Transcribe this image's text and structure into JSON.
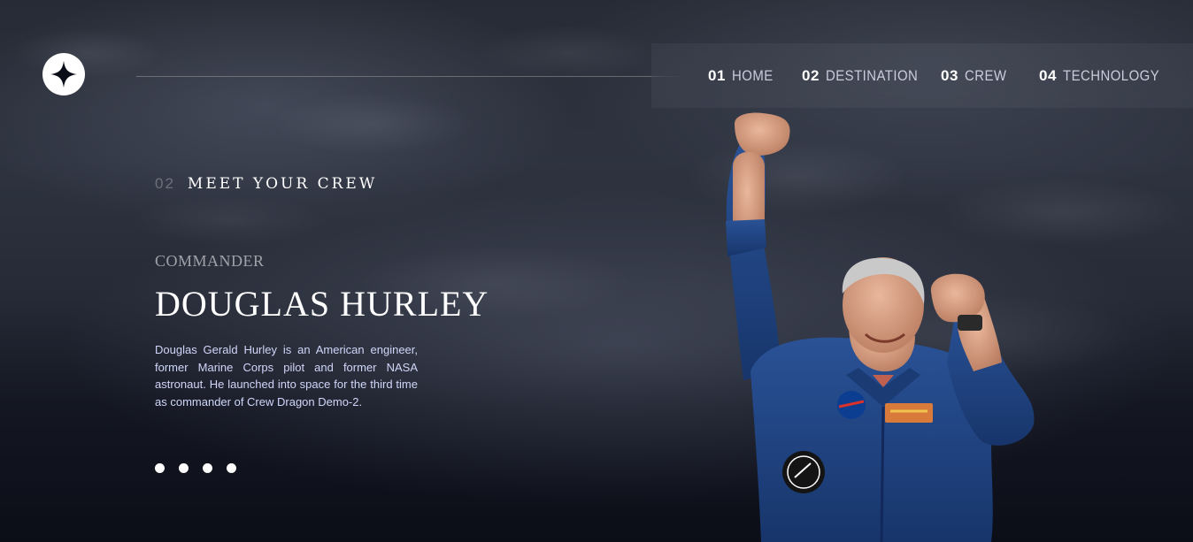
{
  "nav": {
    "items": [
      {
        "num": "01",
        "label": "HOME"
      },
      {
        "num": "02",
        "label": "DESTINATION"
      },
      {
        "num": "03",
        "label": "CREW"
      },
      {
        "num": "04",
        "label": "TECHNOLOGY"
      }
    ]
  },
  "heading": {
    "num": "02",
    "title": "MEET YOUR CREW"
  },
  "crew": {
    "role": "COMMANDER",
    "name": "DOUGLAS HURLEY",
    "bio": "Douglas Gerald Hurley is an American engineer, former Marine Corps pilot and former NASA astronaut. He launched into space for the third time as commander of Crew Dragon Demo-2."
  },
  "pagination": {
    "count": 4,
    "active_index": 0
  },
  "icons": {
    "logo": "star-logo-icon"
  },
  "colors": {
    "background": "#0b0d17",
    "text": "#ffffff",
    "muted": "#d0d6f9",
    "suit": "#1d3f7a"
  }
}
